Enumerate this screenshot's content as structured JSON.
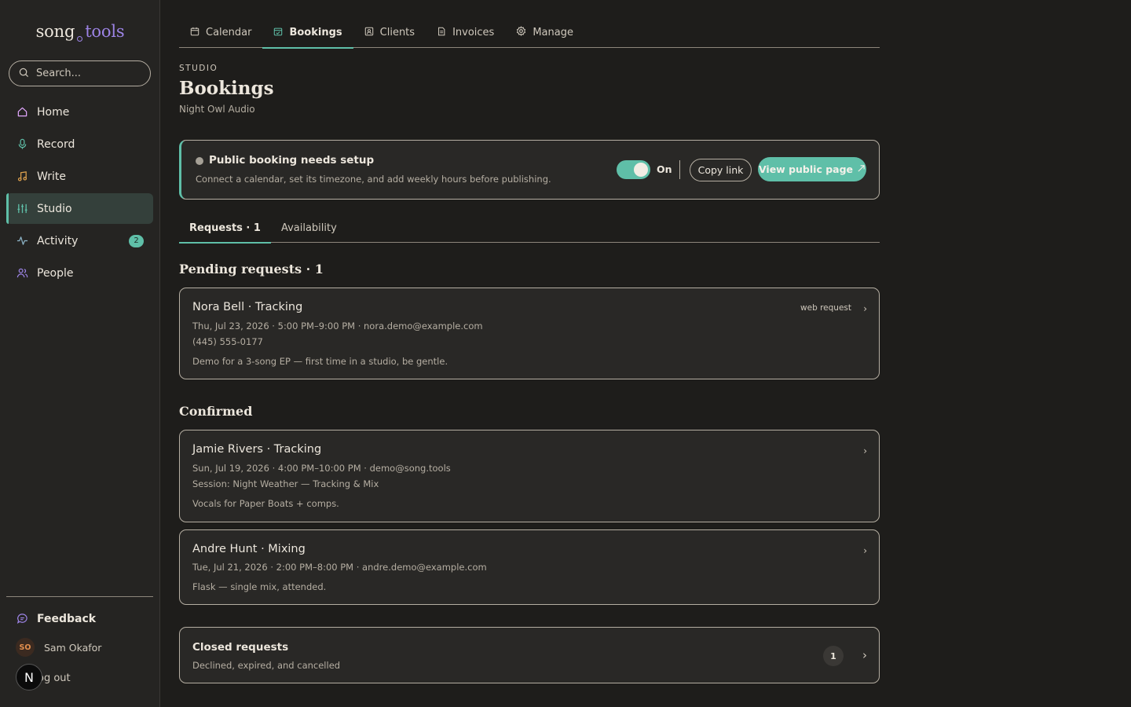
{
  "app": {
    "logo_part1": "song",
    "logo_part2": "tools"
  },
  "search": {
    "placeholder": "Search..."
  },
  "sidebar": {
    "items": [
      {
        "label": "Home",
        "icon": "home-icon"
      },
      {
        "label": "Record",
        "icon": "microphone-icon"
      },
      {
        "label": "Write",
        "icon": "music-note-icon"
      },
      {
        "label": "Studio",
        "icon": "sliders-icon",
        "active": true
      },
      {
        "label": "Activity",
        "icon": "activity-icon",
        "badge": "2"
      },
      {
        "label": "People",
        "icon": "people-icon"
      }
    ],
    "feedback": "Feedback",
    "user": {
      "initials": "SO",
      "name": "Sam Okafor"
    },
    "logout": "og out",
    "n_button": "N"
  },
  "tabs": [
    {
      "label": "Calendar",
      "icon": "calendar-icon"
    },
    {
      "label": "Bookings",
      "icon": "calendar-check-icon",
      "active": true
    },
    {
      "label": "Clients",
      "icon": "contact-card-icon"
    },
    {
      "label": "Invoices",
      "icon": "document-icon"
    },
    {
      "label": "Manage",
      "icon": "gear-icon"
    }
  ],
  "header": {
    "eyebrow": "STUDIO",
    "title": "Bookings",
    "subtitle": "Night Owl Audio"
  },
  "setup_banner": {
    "title": "Public booking needs setup",
    "description": "Connect a calendar, set its timezone, and add weekly hours before publishing.",
    "toggle_label": "On",
    "toggle_on": true,
    "copy_link": "Copy link",
    "view_public_page": "View public page"
  },
  "subtabs": [
    {
      "label": "Requests · 1",
      "active": true
    },
    {
      "label": "Availability"
    }
  ],
  "pending": {
    "heading": "Pending requests · 1",
    "items": [
      {
        "title": "Nora Bell · Tracking",
        "tag": "web request",
        "line1": "Thu, Jul 23, 2026 · 5:00 PM–9:00 PM · nora.demo@example.com",
        "line2": "(445) 555-0177",
        "note": "Demo for a 3-song EP — first time in a studio, be gentle."
      }
    ]
  },
  "confirmed": {
    "heading": "Confirmed",
    "items": [
      {
        "title": "Jamie Rivers · Tracking",
        "line1": "Sun, Jul 19, 2026 · 4:00 PM–10:00 PM · demo@song.tools",
        "line2": "Session: Night Weather — Tracking & Mix",
        "note": "Vocals for Paper Boats + comps."
      },
      {
        "title": "Andre Hunt · Mixing",
        "line1": "Tue, Jul 21, 2026 · 2:00 PM–8:00 PM · andre.demo@example.com",
        "note": "Flask — single mix, attended."
      }
    ]
  },
  "closed": {
    "title": "Closed requests",
    "description": "Declined, expired, and cancelled",
    "count": "1"
  },
  "colors": {
    "accent": "#5fbfa8",
    "logo_accent": "#9d84e6",
    "background": "#1e1d1b",
    "sidebar": "#252422"
  }
}
